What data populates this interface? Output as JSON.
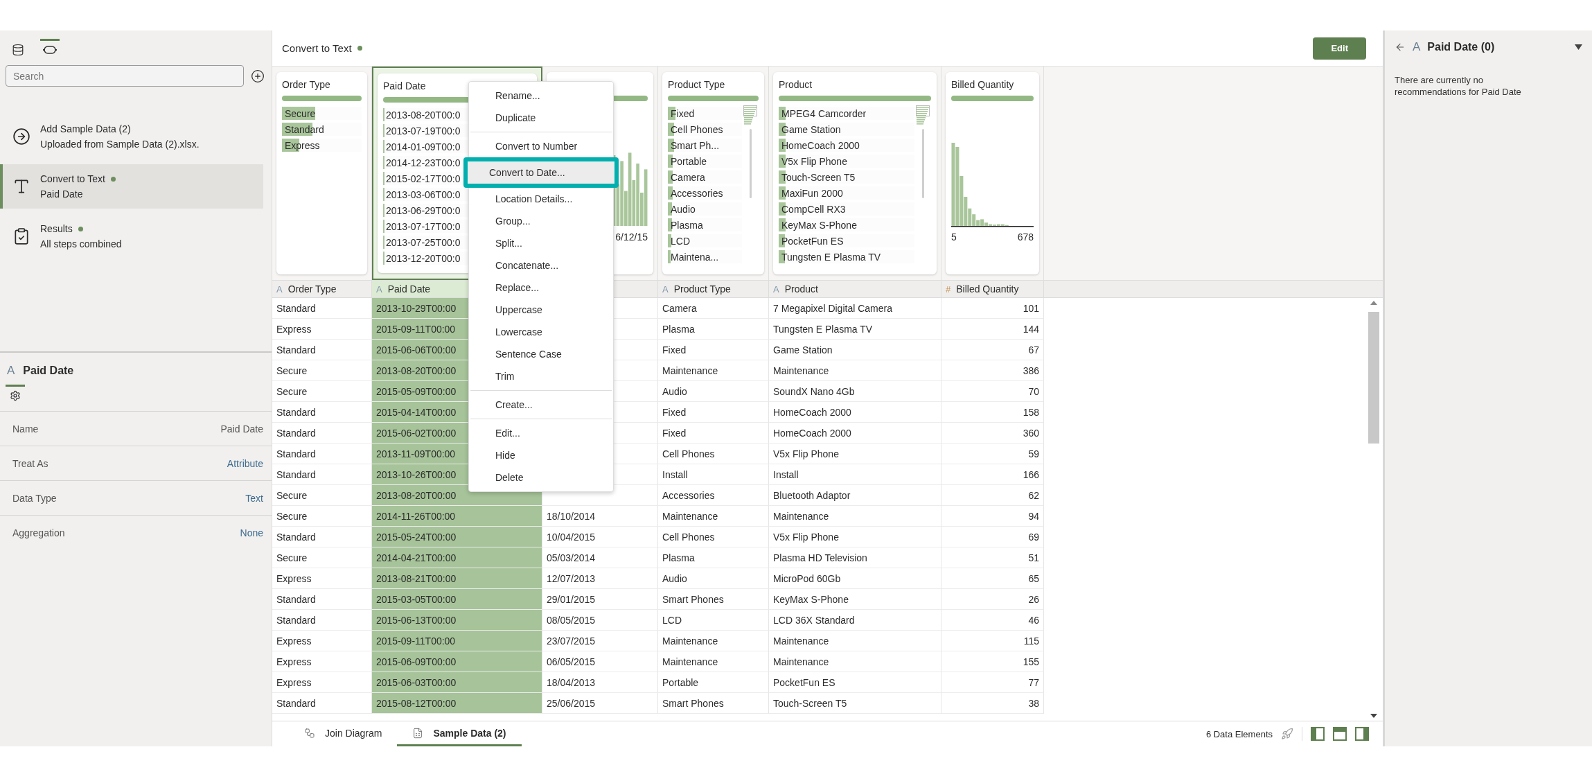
{
  "left_panel": {
    "view_tabs": [
      {
        "kind": "database",
        "selected": false
      },
      {
        "kind": "steps",
        "selected": true
      }
    ],
    "search": {
      "placeholder": "Search"
    },
    "steps": [
      {
        "kind": "add",
        "title": "Add Sample Data (2)",
        "subtitle": "Uploaded from Sample Data (2).xlsx.",
        "dot": false,
        "selected": false
      },
      {
        "kind": "text",
        "title": "Convert to Text",
        "subtitle": "Paid Date",
        "dot": true,
        "selected": true
      },
      {
        "kind": "results",
        "title": "Results",
        "subtitle": "All steps combined",
        "dot": true,
        "selected": false
      }
    ],
    "properties": {
      "glyph": "A",
      "title": "Paid Date",
      "tabs": [
        {
          "kind": "settings",
          "selected": true
        }
      ],
      "rows": [
        {
          "label": "Name",
          "value": "Paid Date",
          "link": false
        },
        {
          "label": "Treat As",
          "value": "Attribute",
          "link": true
        },
        {
          "label": "Data Type",
          "value": "Text",
          "link": true
        },
        {
          "label": "Aggregation",
          "value": "None",
          "link": true
        }
      ]
    }
  },
  "main": {
    "title": "Convert to Text",
    "dot": true,
    "edit_button": "Edit"
  },
  "columns": [
    {
      "name": "Order Type",
      "glyph": "A",
      "selected": false,
      "card": {
        "kind": "list",
        "title": "Order Type",
        "scrollable": false,
        "items": [
          {
            "label": "Secure",
            "level": 0.42
          },
          {
            "label": "Standard",
            "level": 0.38
          },
          {
            "label": "Express",
            "level": 0.22
          }
        ]
      }
    },
    {
      "name": "Paid Date",
      "glyph": "A",
      "selected": true,
      "card": {
        "kind": "list",
        "title": "Paid Date",
        "scrollable": false,
        "items": [
          {
            "label": "2013-08-20T00:0",
            "level": 0.01
          },
          {
            "label": "2013-07-19T00:0",
            "level": 0.01
          },
          {
            "label": "2014-01-09T00:0",
            "level": 0.01
          },
          {
            "label": "2014-12-23T00:0",
            "level": 0.01
          },
          {
            "label": "2015-02-17T00:0",
            "level": 0.01
          },
          {
            "label": "2013-03-06T00:0",
            "level": 0.01
          },
          {
            "label": "2013-06-29T00:0",
            "level": 0.01
          },
          {
            "label": "2013-07-17T00:0",
            "level": 0.01
          },
          {
            "label": "2013-07-25T00:0",
            "level": 0.01
          },
          {
            "label": "2013-12-20T00:0",
            "level": 0.01
          }
        ]
      }
    },
    {
      "selected": false,
      "card": {
        "kind": "histogram",
        "range_end": "6/12/15"
      }
    },
    {
      "name": "Product Type",
      "glyph": "A",
      "selected": false,
      "card": {
        "kind": "list",
        "title": "Product Type",
        "scrollable": true,
        "items": [
          {
            "label": "Fixed",
            "level": 0.1
          },
          {
            "label": "Cell Phones",
            "level": 0.08
          },
          {
            "label": "Smart Ph...",
            "level": 0.08
          },
          {
            "label": "Portable",
            "level": 0.07
          },
          {
            "label": "Camera",
            "level": 0.07
          },
          {
            "label": "Accessories",
            "level": 0.07
          },
          {
            "label": "Audio",
            "level": 0.06
          },
          {
            "label": "Plasma",
            "level": 0.06
          },
          {
            "label": "LCD",
            "level": 0.05
          },
          {
            "label": "Maintena...",
            "level": 0.04
          }
        ]
      }
    },
    {
      "name": "Product",
      "glyph": "A",
      "selected": false,
      "card": {
        "kind": "list",
        "title": "Product",
        "scrollable": true,
        "items": [
          {
            "label": "MPEG4 Camcorder",
            "level": 0.05
          },
          {
            "label": "Game Station",
            "level": 0.05
          },
          {
            "label": "HomeCoach 2000",
            "level": 0.05
          },
          {
            "label": "V5x Flip Phone",
            "level": 0.05
          },
          {
            "label": "Touch-Screen T5",
            "level": 0.05
          },
          {
            "label": "MaxiFun 2000",
            "level": 0.05
          },
          {
            "label": "CompCell RX3",
            "level": 0.05
          },
          {
            "label": "KeyMax S-Phone",
            "level": 0.05
          },
          {
            "label": "PocketFun ES",
            "level": 0.045
          },
          {
            "label": "Tungsten E Plasma TV",
            "level": 0.045
          }
        ]
      }
    },
    {
      "name": "Billed Quantity",
      "glyph": "#",
      "selected": false,
      "card": {
        "kind": "histogram",
        "title": "Billed Quantity",
        "range_start": "5",
        "range_end": "678"
      }
    }
  ],
  "rows": [
    [
      "Standard",
      "2013-10-29T00:00",
      null,
      "Camera",
      "7 Megapixel Digital Camera",
      "101"
    ],
    [
      "Express",
      "2015-09-11T00:00",
      null,
      "Plasma",
      "Tungsten E Plasma TV",
      "144"
    ],
    [
      "Standard",
      "2015-06-06T00:00",
      null,
      "Fixed",
      "Game Station",
      "67"
    ],
    [
      "Secure",
      "2013-08-20T00:00",
      null,
      "Maintenance",
      "Maintenance",
      "386"
    ],
    [
      "Secure",
      "2015-05-09T00:00",
      null,
      "Audio",
      "SoundX Nano 4Gb",
      "70"
    ],
    [
      "Standard",
      "2015-04-14T00:00",
      null,
      "Fixed",
      "HomeCoach 2000",
      "158"
    ],
    [
      "Standard",
      "2015-06-02T00:00",
      null,
      "Fixed",
      "HomeCoach 2000",
      "360"
    ],
    [
      "Standard",
      "2013-11-09T00:00",
      null,
      "Cell Phones",
      "V5x Flip Phone",
      "59"
    ],
    [
      "Standard",
      "2013-10-26T00:00",
      null,
      "Install",
      "Install",
      "166"
    ],
    [
      "Secure",
      "2013-08-20T00:00",
      null,
      "Accessories",
      "Bluetooth Adaptor",
      "62"
    ],
    [
      "Secure",
      "2014-11-26T00:00",
      "18/10/2014",
      "Maintenance",
      "Maintenance",
      "94"
    ],
    [
      "Standard",
      "2015-05-24T00:00",
      "10/04/2015",
      "Cell Phones",
      "V5x Flip Phone",
      "69"
    ],
    [
      "Secure",
      "2014-04-21T00:00",
      "05/03/2014",
      "Plasma",
      "Plasma HD Television",
      "51"
    ],
    [
      "Express",
      "2013-08-21T00:00",
      "12/07/2013",
      "Audio",
      "MicroPod 60Gb",
      "65"
    ],
    [
      "Standard",
      "2015-03-05T00:00",
      "29/01/2015",
      "Smart Phones",
      "KeyMax S-Phone",
      "26"
    ],
    [
      "Standard",
      "2015-06-13T00:00",
      "08/05/2015",
      "LCD",
      "LCD 36X Standard",
      "46"
    ],
    [
      "Express",
      "2015-09-11T00:00",
      "23/07/2015",
      "Maintenance",
      "Maintenance",
      "115"
    ],
    [
      "Express",
      "2015-06-09T00:00",
      "06/05/2015",
      "Maintenance",
      "Maintenance",
      "155"
    ],
    [
      "Express",
      "2015-06-03T00:00",
      "18/04/2013",
      "Portable",
      "PocketFun ES",
      "77"
    ],
    [
      "Standard",
      "2015-08-12T00:00",
      "25/06/2015",
      "Smart Phones",
      "Touch-Screen T5",
      "38"
    ]
  ],
  "context_menu": {
    "groups": [
      [
        {
          "label": "Rename...",
          "highlighted": false
        },
        {
          "label": "Duplicate",
          "highlighted": false
        }
      ],
      [
        {
          "label": "Convert to Number",
          "highlighted": false
        },
        {
          "label": "Convert to Date...",
          "highlighted": true
        },
        {
          "label": "Location Details...",
          "highlighted": false
        },
        {
          "label": "Group...",
          "highlighted": false
        },
        {
          "label": "Split...",
          "highlighted": false
        },
        {
          "label": "Concatenate...",
          "highlighted": false
        },
        {
          "label": "Replace...",
          "highlighted": false
        },
        {
          "label": "Uppercase",
          "highlighted": false
        },
        {
          "label": "Lowercase",
          "highlighted": false
        },
        {
          "label": "Sentence Case",
          "highlighted": false
        },
        {
          "label": "Trim",
          "highlighted": false
        }
      ],
      [
        {
          "label": "Create...",
          "highlighted": false
        }
      ],
      [
        {
          "label": "Edit...",
          "highlighted": false
        },
        {
          "label": "Hide",
          "highlighted": false
        },
        {
          "label": "Delete",
          "highlighted": false
        }
      ]
    ]
  },
  "bottom_bar": {
    "tabs": [
      {
        "kind": "diagram",
        "label": "Join Diagram",
        "selected": false
      },
      {
        "kind": "sheet",
        "label": "Sample Data (2)",
        "selected": true
      }
    ],
    "count": "6 Data Elements",
    "layout_buttons": [
      {
        "kind": "left"
      },
      {
        "kind": "top"
      },
      {
        "kind": "right"
      }
    ]
  },
  "right_panel": {
    "glyph": "A",
    "title": "Paid Date (0)",
    "message": "There are currently no recommendations for Paid Date"
  }
}
